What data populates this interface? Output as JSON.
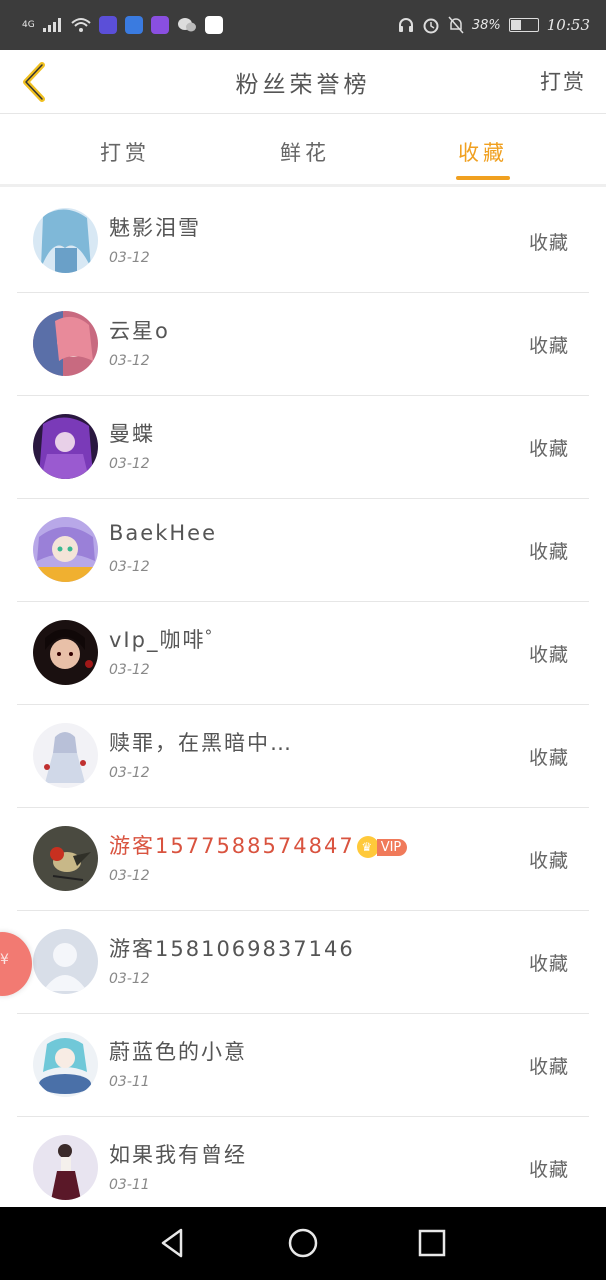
{
  "status_bar": {
    "network": "4G",
    "battery": "38%",
    "battery_level": 0.38,
    "time": "10:53"
  },
  "header": {
    "title": "粉丝荣誉榜",
    "right_label": "打赏"
  },
  "tabs": [
    {
      "label": "打赏",
      "active": false
    },
    {
      "label": "鲜花",
      "active": false
    },
    {
      "label": "收藏",
      "active": true
    }
  ],
  "fans": [
    {
      "name": "魅影泪雪",
      "date": "03-12",
      "action": "收藏",
      "vip": false
    },
    {
      "name": "云星o",
      "date": "03-12",
      "action": "收藏",
      "vip": false
    },
    {
      "name": "曼蝶",
      "date": "03-12",
      "action": "收藏",
      "vip": false
    },
    {
      "name": "BaekHee",
      "date": "03-12",
      "action": "收藏",
      "vip": false
    },
    {
      "name": "vIp_咖啡゜",
      "date": "03-12",
      "action": "收藏",
      "vip": false
    },
    {
      "name": "赎罪，在黑暗中…",
      "date": "03-12",
      "action": "收藏",
      "vip": false
    },
    {
      "name": "游客1577588574847",
      "date": "03-12",
      "action": "收藏",
      "vip": true,
      "vip_label": "VIP"
    },
    {
      "name": "游客1581069837146",
      "date": "03-12",
      "action": "收藏",
      "vip": false
    },
    {
      "name": "蔚蓝色的小意",
      "date": "03-11",
      "action": "收藏",
      "vip": false
    },
    {
      "name": "如果我有曾经",
      "date": "03-11",
      "action": "收藏",
      "vip": false
    }
  ],
  "float_badge": {
    "symbol": "¥"
  },
  "colors": {
    "accent": "#f0a020",
    "vip_name": "#d9533f",
    "status_bar_bg": "#3c3c3c",
    "nav_bar_bg": "#000000"
  }
}
